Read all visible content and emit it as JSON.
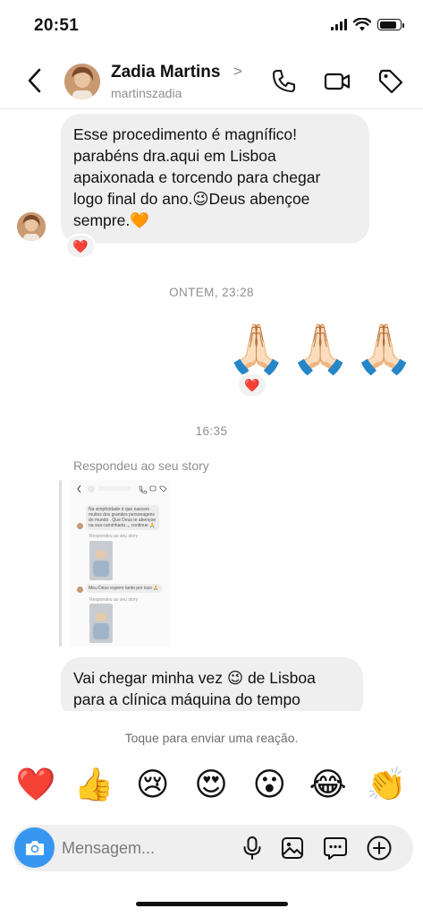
{
  "status_bar": {
    "time": "20:51",
    "battery_level": 0.85
  },
  "header": {
    "contact_name": "Zadia Martins",
    "name_chevron": ">",
    "username": "martinszadia",
    "icons": [
      "back-chevron-icon",
      "phone-icon",
      "video-camera-icon",
      "tag-icon"
    ]
  },
  "messages": {
    "first": {
      "lines": [
        "Esse procedimento é magnífico!",
        "parabéns dra.aqui em Lisboa",
        "apaixonada e torcendo para chegar",
        "logo final do ano.😉Deus abençoe",
        "sempre.🧡"
      ],
      "reaction": "❤️"
    },
    "timestamp_1": "ONTEM, 23:28",
    "prayer": {
      "emojis": [
        "🙏🏻",
        "🙏🏻",
        "🙏🏻"
      ],
      "reaction": "❤️"
    },
    "timestamp_2": "16:35",
    "story_reply": {
      "label": "Respondeu ao seu story",
      "preview": {
        "bubble_1": "Na simplicidade é que nascem muitos dos grandes personagens do mundo . Que Deus te abençoe na sua caminhada ,,, continue 🙏",
        "replied_1": "Respondeu ao seu story",
        "bubble_2": "Meu Deus espero tanto por isso 🙏",
        "replied_2": "Respondeu ao seu story"
      }
    },
    "second": {
      "lines": [
        "Vai chegar minha vez 😉 de Lisboa",
        "para  a clínica máquina do tempo"
      ]
    }
  },
  "reactions": {
    "hint": "Toque para enviar uma reação.",
    "emojis": [
      "❤️",
      "👍",
      "😢",
      "😍",
      "😮",
      "😂",
      "👏"
    ]
  },
  "composer": {
    "placeholder": "Mensagem...",
    "icons": [
      "camera-icon",
      "microphone-icon",
      "gallery-icon",
      "sticker-chat-icon",
      "add-circle-icon"
    ]
  },
  "colors": {
    "accent": "#3797f0",
    "bubble": "#efefef",
    "secondary_text": "#8e8e8e"
  }
}
